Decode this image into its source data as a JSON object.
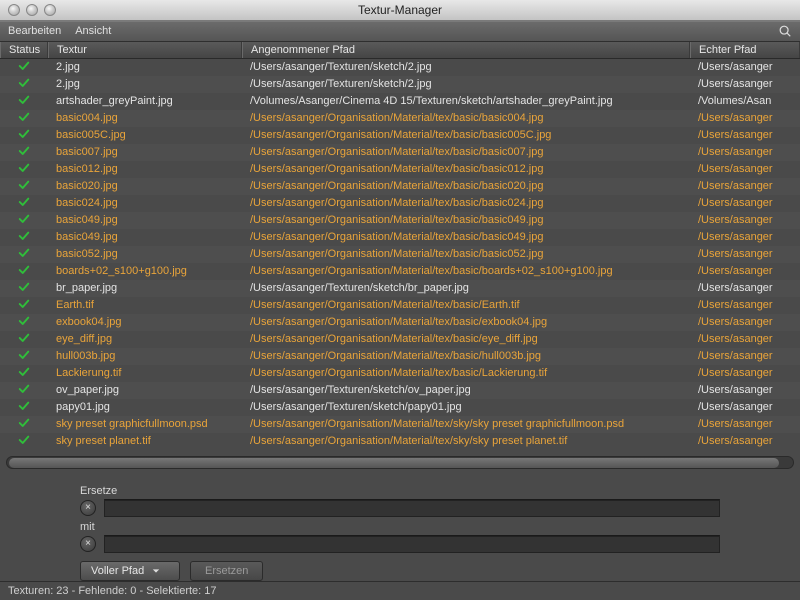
{
  "window": {
    "title": "Textur-Manager"
  },
  "menu": {
    "edit": "Bearbeiten",
    "view": "Ansicht"
  },
  "columns": {
    "status": "Status",
    "texture": "Textur",
    "assumed_path": "Angenommener Pfad",
    "real_path": "Echter Pfad"
  },
  "rows": [
    {
      "ok": true,
      "sel": false,
      "tex": "2.jpg",
      "path": "/Users/asanger/Texturen/sketch/2.jpg",
      "real": "/Users/asanger"
    },
    {
      "ok": true,
      "sel": false,
      "tex": "2.jpg",
      "path": "/Users/asanger/Texturen/sketch/2.jpg",
      "real": "/Users/asanger"
    },
    {
      "ok": true,
      "sel": false,
      "tex": "artshader_greyPaint.jpg",
      "path": "/Volumes/Asanger/Cinema 4D 15/Texturen/sketch/artshader_greyPaint.jpg",
      "real": "/Volumes/Asan"
    },
    {
      "ok": true,
      "sel": true,
      "tex": "basic004.jpg",
      "path": "/Users/asanger/Organisation/Material/tex/basic/basic004.jpg",
      "real": "/Users/asanger"
    },
    {
      "ok": true,
      "sel": true,
      "tex": "basic005C.jpg",
      "path": "/Users/asanger/Organisation/Material/tex/basic/basic005C.jpg",
      "real": "/Users/asanger"
    },
    {
      "ok": true,
      "sel": true,
      "tex": "basic007.jpg",
      "path": "/Users/asanger/Organisation/Material/tex/basic/basic007.jpg",
      "real": "/Users/asanger"
    },
    {
      "ok": true,
      "sel": true,
      "tex": "basic012.jpg",
      "path": "/Users/asanger/Organisation/Material/tex/basic/basic012.jpg",
      "real": "/Users/asanger"
    },
    {
      "ok": true,
      "sel": true,
      "tex": "basic020.jpg",
      "path": "/Users/asanger/Organisation/Material/tex/basic/basic020.jpg",
      "real": "/Users/asanger"
    },
    {
      "ok": true,
      "sel": true,
      "tex": "basic024.jpg",
      "path": "/Users/asanger/Organisation/Material/tex/basic/basic024.jpg",
      "real": "/Users/asanger"
    },
    {
      "ok": true,
      "sel": true,
      "tex": "basic049.jpg",
      "path": "/Users/asanger/Organisation/Material/tex/basic/basic049.jpg",
      "real": "/Users/asanger"
    },
    {
      "ok": true,
      "sel": true,
      "tex": "basic049.jpg",
      "path": "/Users/asanger/Organisation/Material/tex/basic/basic049.jpg",
      "real": "/Users/asanger"
    },
    {
      "ok": true,
      "sel": true,
      "tex": "basic052.jpg",
      "path": "/Users/asanger/Organisation/Material/tex/basic/basic052.jpg",
      "real": "/Users/asanger"
    },
    {
      "ok": true,
      "sel": true,
      "tex": "boards+02_s100+g100.jpg",
      "path": "/Users/asanger/Organisation/Material/tex/basic/boards+02_s100+g100.jpg",
      "real": "/Users/asanger"
    },
    {
      "ok": true,
      "sel": false,
      "tex": "br_paper.jpg",
      "path": "/Users/asanger/Texturen/sketch/br_paper.jpg",
      "real": "/Users/asanger"
    },
    {
      "ok": true,
      "sel": true,
      "tex": "Earth.tif",
      "path": "/Users/asanger/Organisation/Material/tex/basic/Earth.tif",
      "real": "/Users/asanger"
    },
    {
      "ok": true,
      "sel": true,
      "tex": "exbook04.jpg",
      "path": "/Users/asanger/Organisation/Material/tex/basic/exbook04.jpg",
      "real": "/Users/asanger"
    },
    {
      "ok": true,
      "sel": true,
      "tex": "eye_diff.jpg",
      "path": "/Users/asanger/Organisation/Material/tex/basic/eye_diff.jpg",
      "real": "/Users/asanger"
    },
    {
      "ok": true,
      "sel": true,
      "tex": "hull003b.jpg",
      "path": "/Users/asanger/Organisation/Material/tex/basic/hull003b.jpg",
      "real": "/Users/asanger"
    },
    {
      "ok": true,
      "sel": true,
      "tex": "Lackierung.tif",
      "path": "/Users/asanger/Organisation/Material/tex/basic/Lackierung.tif",
      "real": "/Users/asanger"
    },
    {
      "ok": true,
      "sel": false,
      "tex": "ov_paper.jpg",
      "path": "/Users/asanger/Texturen/sketch/ov_paper.jpg",
      "real": "/Users/asanger"
    },
    {
      "ok": true,
      "sel": false,
      "tex": "papy01.jpg",
      "path": "/Users/asanger/Texturen/sketch/papy01.jpg",
      "real": "/Users/asanger"
    },
    {
      "ok": true,
      "sel": true,
      "tex": "sky preset graphicfullmoon.psd",
      "path": "/Users/asanger/Organisation/Material/tex/sky/sky preset graphicfullmoon.psd",
      "real": "/Users/asanger"
    },
    {
      "ok": true,
      "sel": true,
      "tex": "sky preset planet.tif",
      "path": "/Users/asanger/Organisation/Material/tex/sky/sky preset planet.tif",
      "real": "/Users/asanger"
    }
  ],
  "form": {
    "replace_label": "Ersetze",
    "with_label": "mit",
    "dropdown_value": "Voller Pfad",
    "action_label": "Ersetzen",
    "input1": "",
    "input2": ""
  },
  "status": "Texturen: 23 - Fehlende: 0 - Selektierte: 17"
}
